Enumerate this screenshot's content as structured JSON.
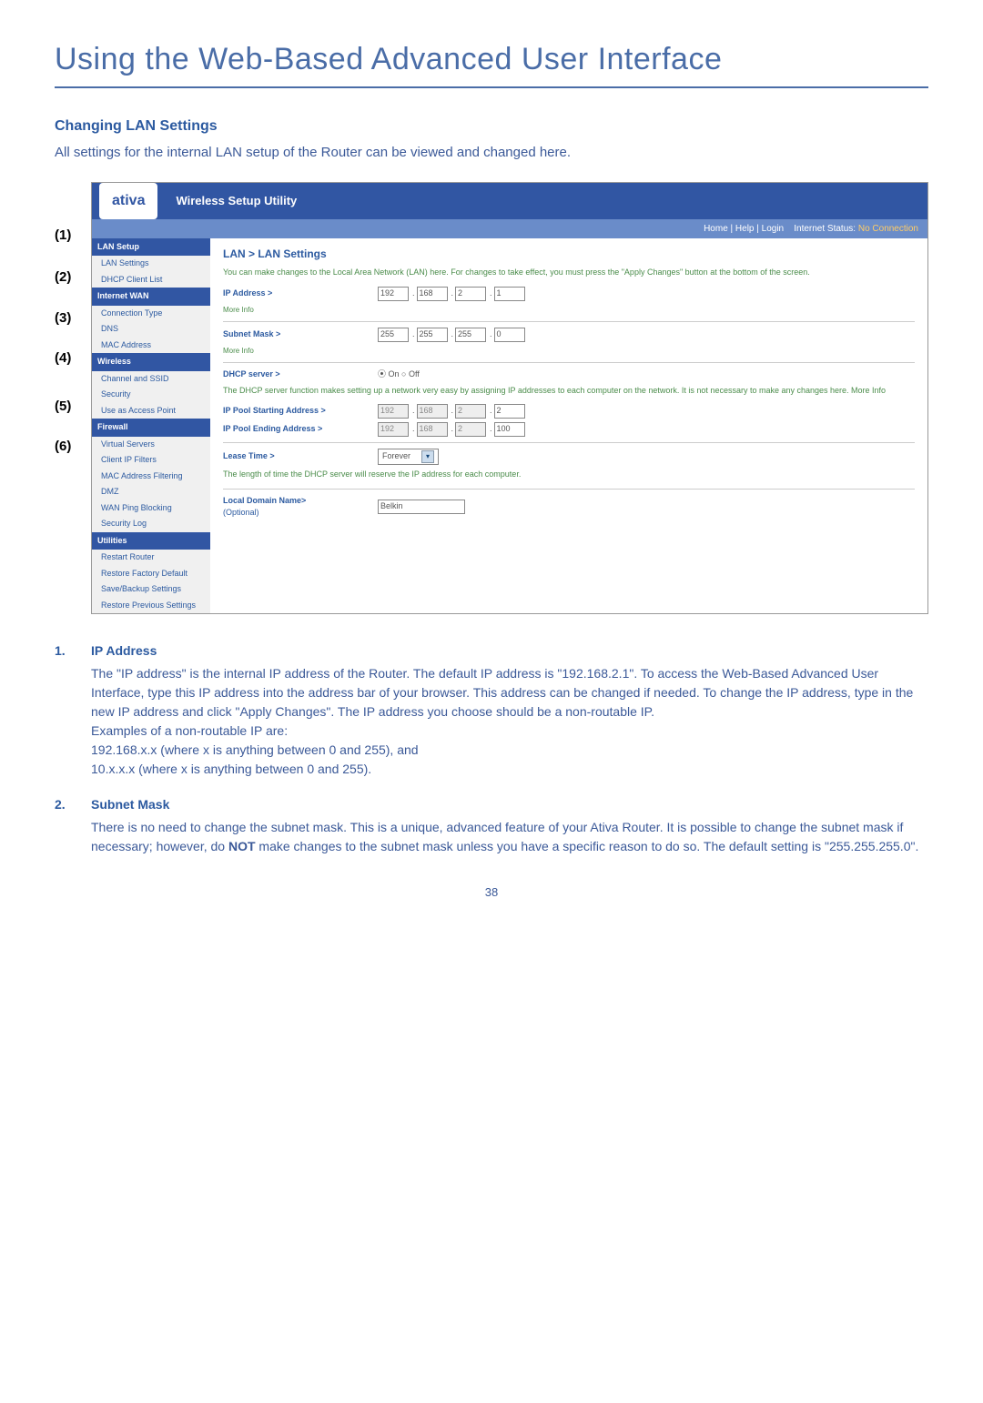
{
  "page_title": "Using the Web-Based Advanced User Interface",
  "section_heading": "Changing LAN Settings",
  "intro": "All settings for the internal LAN setup of the Router can be viewed and changed here.",
  "callouts": [
    "(1)",
    "(2)",
    "(3)",
    "(4)",
    "(5)",
    "(6)"
  ],
  "screenshot": {
    "logo": "ativa",
    "header_title": "Wireless Setup Utility",
    "topbar": {
      "links": "Home | Help | Login",
      "status_label": "Internet Status:",
      "status_value": "No Connection"
    },
    "sidebar": {
      "groups": [
        {
          "head": "LAN Setup",
          "items": [
            "LAN Settings",
            "DHCP Client List"
          ]
        },
        {
          "head": "Internet WAN",
          "items": [
            "Connection Type",
            "DNS",
            "MAC Address"
          ]
        },
        {
          "head": "Wireless",
          "items": [
            "Channel and SSID",
            "Security",
            "Use as Access Point"
          ]
        },
        {
          "head": "Firewall",
          "items": [
            "Virtual Servers",
            "Client IP Filters",
            "MAC Address Filtering",
            "DMZ",
            "WAN Ping Blocking",
            "Security Log"
          ]
        },
        {
          "head": "Utilities",
          "items": [
            "Restart Router",
            "Restore Factory Default",
            "Save/Backup Settings",
            "Restore Previous Settings"
          ]
        }
      ]
    },
    "main": {
      "title": "LAN > LAN Settings",
      "note": "You can make changes to the Local Area Network (LAN) here. For changes to take effect, you must press the \"Apply Changes\" button at the bottom of the screen.",
      "ip_label": "IP Address >",
      "ip": [
        "192",
        "168",
        "2",
        "1"
      ],
      "more_info": "More Info",
      "subnet_label": "Subnet Mask >",
      "subnet": [
        "255",
        "255",
        "255",
        "0"
      ],
      "dhcp_label": "DHCP server >",
      "dhcp_on": "On",
      "dhcp_off": "Off",
      "dhcp_note": "The DHCP server function makes setting up a network very easy by assigning IP addresses to each computer on the network. It is not necessary to make any changes here. More Info",
      "pool_start_label": "IP Pool Starting Address >",
      "pool_start": [
        "192",
        "168",
        "2",
        "2"
      ],
      "pool_end_label": "IP Pool Ending Address >",
      "pool_end": [
        "192",
        "168",
        "2",
        "100"
      ],
      "lease_label": "Lease Time >",
      "lease_value": "Forever",
      "lease_note": "The length of time the DHCP server will reserve the IP address for each computer.",
      "domain_label": "Local Domain Name>",
      "domain_optional": "(Optional)",
      "domain_value": "Belkin"
    }
  },
  "items": [
    {
      "num": "1.",
      "title": "IP Address",
      "body": "The \"IP address\" is the internal IP address of the Router. The default IP address is \"192.168.2.1\". To access the Web-Based Advanced User Interface, type this IP address into the address bar of your browser. This address can be changed if needed. To change the IP address, type in the new IP address and click \"Apply Changes\". The IP address you choose should be a non-routable IP.",
      "extra1": "Examples of a non-routable IP are:",
      "extra2": "192.168.x.x (where x is anything between 0 and 255), and",
      "extra3": "10.x.x.x (where x is anything between 0 and 255)."
    },
    {
      "num": "2.",
      "title": "Subnet Mask",
      "body_pre": "There is no need to change the subnet mask. This is a unique, advanced feature of your Ativa Router. It is possible to change the subnet mask if necessary; however, do ",
      "body_strong": "NOT",
      "body_post": " make changes to the subnet mask unless you have a specific reason to do so. The default setting is \"255.255.255.0\"."
    }
  ],
  "page_number": "38"
}
